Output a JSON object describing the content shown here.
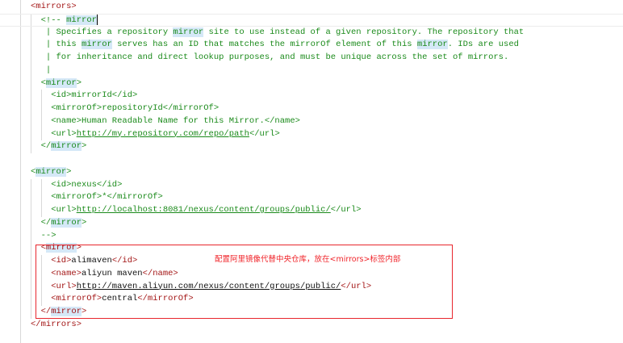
{
  "annotation": {
    "text": "配置阿里镜像代替中央仓库，放在<mirrors>标签内部",
    "color": "#e8262d"
  },
  "lines": [
    {
      "indent": 0,
      "segs": [
        {
          "t": "<mirrors>",
          "k": "t"
        }
      ]
    },
    {
      "indent": 1,
      "current": true,
      "caret": true,
      "segs": [
        {
          "t": "<!-- ",
          "k": "c"
        },
        {
          "t": "mirror",
          "k": "c",
          "h": true
        }
      ]
    },
    {
      "indent": 1,
      "segs": [
        {
          "t": " | Specifies a repository ",
          "k": "c"
        },
        {
          "t": "mirror",
          "k": "c",
          "h": true
        },
        {
          "t": " site to use instead of a given repository. The repository that",
          "k": "c"
        }
      ]
    },
    {
      "indent": 1,
      "segs": [
        {
          "t": " | this ",
          "k": "c"
        },
        {
          "t": "mirror",
          "k": "c",
          "h": true
        },
        {
          "t": " serves has an ID that matches the mirrorOf element of this ",
          "k": "c"
        },
        {
          "t": "mirror",
          "k": "c",
          "h": true
        },
        {
          "t": ". IDs are used",
          "k": "c"
        }
      ]
    },
    {
      "indent": 1,
      "segs": [
        {
          "t": " | for inheritance and direct lookup purposes, and must be unique across the set of mirrors.",
          "k": "c"
        }
      ]
    },
    {
      "indent": 1,
      "segs": [
        {
          "t": " |",
          "k": "c"
        }
      ]
    },
    {
      "indent": 1,
      "segs": [
        {
          "t": "<",
          "k": "g"
        },
        {
          "t": "mirror",
          "k": "g",
          "h": true
        },
        {
          "t": ">",
          "k": "g"
        }
      ]
    },
    {
      "indent": 2,
      "segs": [
        {
          "t": "<id>mirrorId</id>",
          "k": "g"
        }
      ]
    },
    {
      "indent": 2,
      "segs": [
        {
          "t": "<mirrorOf>repositoryId</mirrorOf>",
          "k": "g"
        }
      ]
    },
    {
      "indent": 2,
      "segs": [
        {
          "t": "<name>Human Readable Name for this Mirror.</name>",
          "k": "g"
        }
      ]
    },
    {
      "indent": 2,
      "segs": [
        {
          "t": "<url>",
          "k": "g"
        },
        {
          "t": "http://my.repository.com/repo/path",
          "k": "g",
          "u": true
        },
        {
          "t": "</url>",
          "k": "g"
        }
      ]
    },
    {
      "indent": 1,
      "segs": [
        {
          "t": "</",
          "k": "g"
        },
        {
          "t": "mirror",
          "k": "g",
          "h": true
        },
        {
          "t": ">",
          "k": "g"
        }
      ]
    },
    {
      "indent": 0,
      "segs": []
    },
    {
      "indent": 0,
      "segs": [
        {
          "t": "<",
          "k": "g"
        },
        {
          "t": "mirror",
          "k": "g",
          "h": true
        },
        {
          "t": ">",
          "k": "g"
        }
      ]
    },
    {
      "indent": 2,
      "segs": [
        {
          "t": "<id>nexus</id>",
          "k": "g"
        }
      ]
    },
    {
      "indent": 2,
      "segs": [
        {
          "t": "<mirrorOf>*</mirrorOf>",
          "k": "g"
        }
      ]
    },
    {
      "indent": 2,
      "segs": [
        {
          "t": "<url>",
          "k": "g"
        },
        {
          "t": "http://localhost:8081/nexus/content/groups/public/",
          "k": "g",
          "u": true
        },
        {
          "t": "</url>",
          "k": "g"
        }
      ]
    },
    {
      "indent": 1,
      "segs": [
        {
          "t": "</",
          "k": "g"
        },
        {
          "t": "mirror",
          "k": "g",
          "h": true
        },
        {
          "t": ">",
          "k": "g"
        }
      ]
    },
    {
      "indent": 1,
      "segs": [
        {
          "t": "-->",
          "k": "g"
        }
      ]
    },
    {
      "indent": 1,
      "segs": [
        {
          "t": "<",
          "k": "t"
        },
        {
          "t": "mirror",
          "k": "t",
          "h": true
        },
        {
          "t": ">",
          "k": "t"
        }
      ]
    },
    {
      "indent": 2,
      "segs": [
        {
          "t": "<id>",
          "k": "t"
        },
        {
          "t": "alimaven",
          "k": "x"
        },
        {
          "t": "</id>",
          "k": "t"
        }
      ]
    },
    {
      "indent": 2,
      "segs": [
        {
          "t": "<name>",
          "k": "t"
        },
        {
          "t": "aliyun maven",
          "k": "x"
        },
        {
          "t": "</name>",
          "k": "t"
        }
      ]
    },
    {
      "indent": 2,
      "segs": [
        {
          "t": "<url>",
          "k": "t"
        },
        {
          "t": "http://maven.aliyun.com/nexus/content/groups/public/",
          "k": "x",
          "u": true
        },
        {
          "t": "</url>",
          "k": "t"
        }
      ]
    },
    {
      "indent": 2,
      "segs": [
        {
          "t": "<mirrorOf>",
          "k": "t"
        },
        {
          "t": "central",
          "k": "x"
        },
        {
          "t": "</mirrorOf>",
          "k": "t"
        }
      ]
    },
    {
      "indent": 1,
      "segs": [
        {
          "t": "</",
          "k": "t"
        },
        {
          "t": "mirror",
          "k": "t",
          "h": true
        },
        {
          "t": ">",
          "k": "t"
        }
      ]
    },
    {
      "indent": 0,
      "segs": [
        {
          "t": "</mirrors>",
          "k": "t"
        }
      ]
    }
  ]
}
